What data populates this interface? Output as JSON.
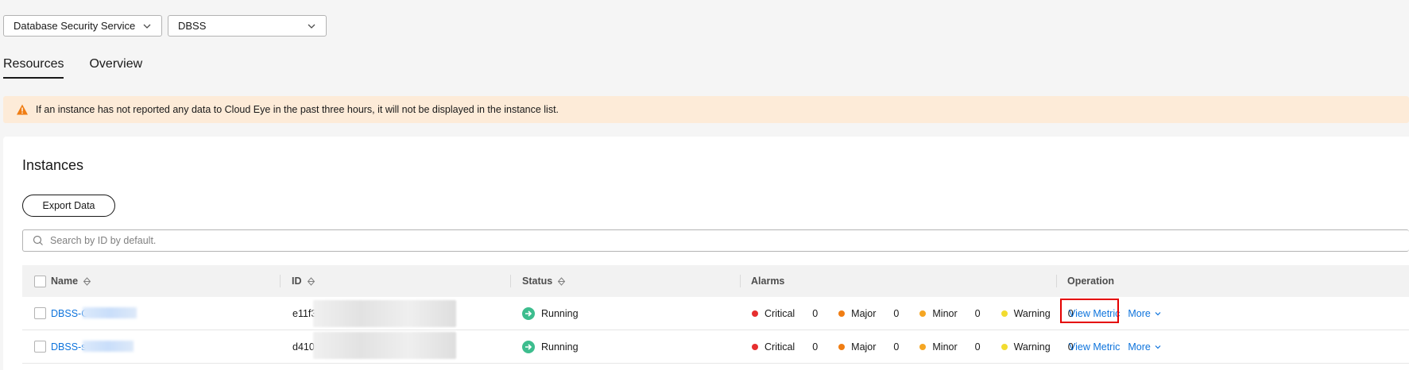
{
  "filters": {
    "service": "Database Security Service",
    "dimension": "DBSS"
  },
  "tabs": [
    {
      "label": "Resources",
      "active": true
    },
    {
      "label": "Overview",
      "active": false
    }
  ],
  "alert": {
    "message": "If an instance has not reported any data to Cloud Eye in the past three hours, it will not be displayed in the instance list."
  },
  "instances": {
    "title": "Instances",
    "export_label": "Export Data",
    "search_placeholder": "Search by ID by default."
  },
  "table": {
    "columns": {
      "name": "Name",
      "id": "ID",
      "status": "Status",
      "alarms": "Alarms",
      "operation": "Operation"
    },
    "rows": [
      {
        "name": "DBSS-C",
        "id": "e11f3",
        "status": "Running",
        "alarms": {
          "critical": "0",
          "major": "0",
          "minor": "0",
          "warning": "0"
        },
        "view_metric": "View Metric",
        "more": "More"
      },
      {
        "name": "DBSS-s",
        "id": "d410",
        "status": "Running",
        "alarms": {
          "critical": "0",
          "major": "0",
          "minor": "0",
          "warning": "0"
        },
        "view_metric": "View Metric",
        "more": "More"
      }
    ]
  },
  "alarm_labels": {
    "critical": "Critical",
    "major": "Major",
    "minor": "Minor",
    "warning": "Warning"
  },
  "colors": {
    "critical": "#e62e2e",
    "major": "#f07d13",
    "minor": "#f5a623",
    "warning": "#f2dc30",
    "link": "#0d73dc",
    "running": "#3dbd8e",
    "alert_bg": "#fdebd8",
    "alert_icon": "#f07d13"
  },
  "icons": {
    "select_arrow": "chevron-down-icon",
    "alert": "warning-triangle-icon",
    "search": "search-icon",
    "sort": "sort-icon",
    "status": "arrow-circle-right-icon"
  }
}
